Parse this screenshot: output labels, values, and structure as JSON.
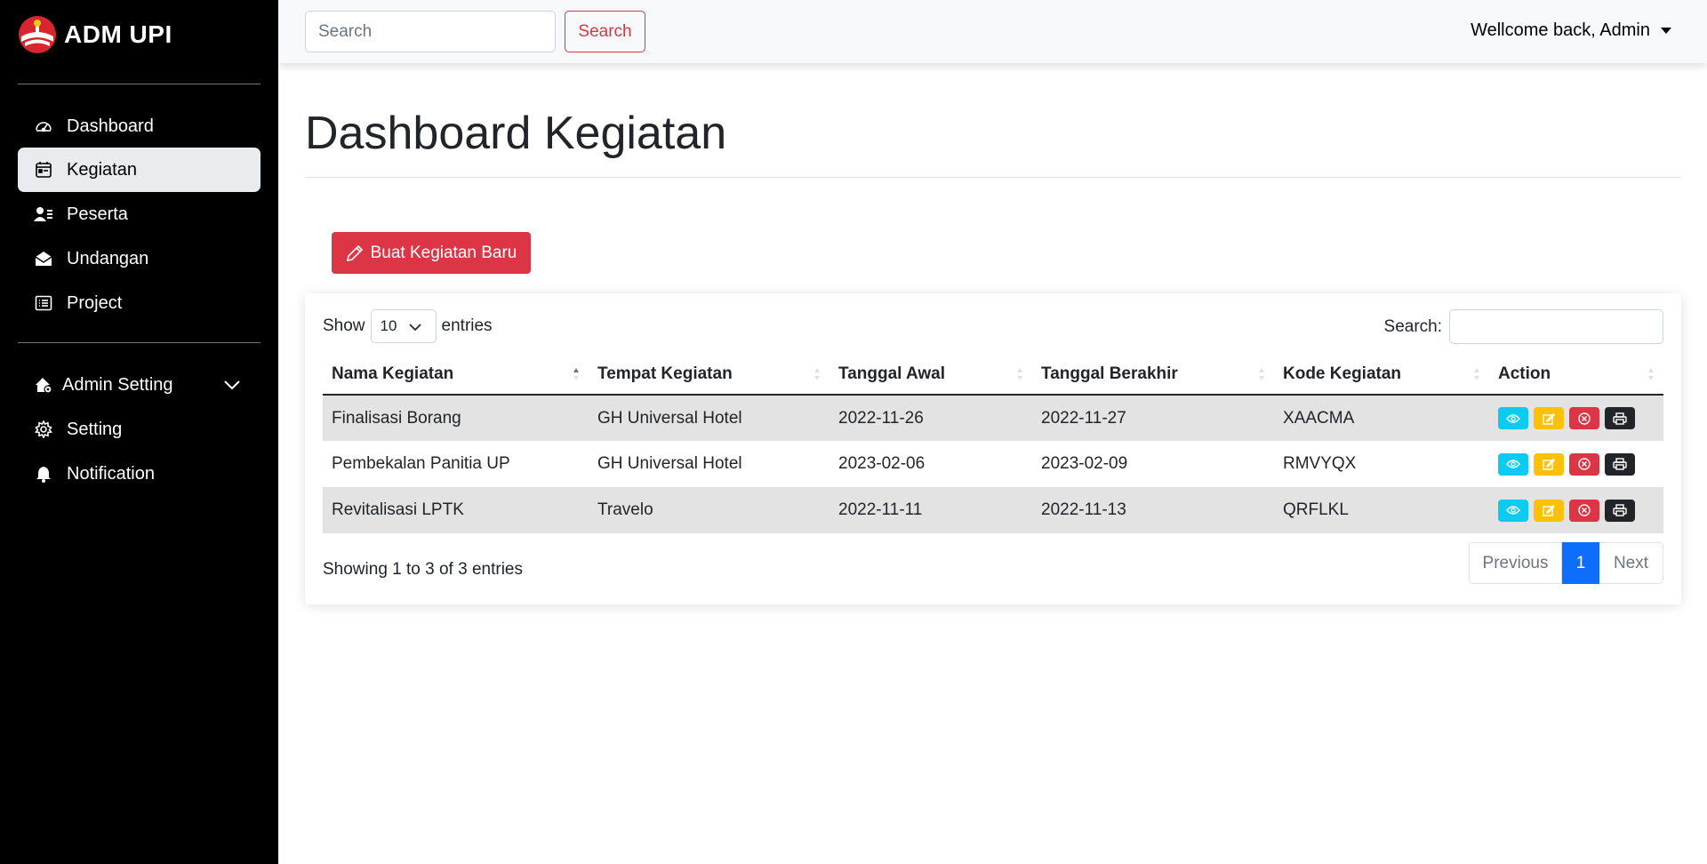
{
  "sidebar": {
    "brand": "ADM UPI",
    "items": [
      {
        "label": "Dashboard",
        "icon": "speedometer-icon"
      },
      {
        "label": "Kegiatan",
        "icon": "calendar-icon",
        "active": true
      },
      {
        "label": "Peserta",
        "icon": "people-icon"
      },
      {
        "label": "Undangan",
        "icon": "envelope-icon"
      },
      {
        "label": "Project",
        "icon": "list-icon"
      }
    ],
    "admin_items": [
      {
        "label": "Admin Setting",
        "icon": "house-gear-icon"
      },
      {
        "label": "Setting",
        "icon": "gear-icon"
      },
      {
        "label": "Notification",
        "icon": "bell-icon"
      }
    ]
  },
  "topbar": {
    "search_placeholder": "Search",
    "search_button": "Search",
    "user_greeting": "Wellcome back, Admin"
  },
  "main": {
    "title": "Dashboard Kegiatan",
    "new_button": "Buat Kegiatan Baru"
  },
  "table": {
    "length_prefix": "Show",
    "length_value": "10",
    "length_suffix": "entries",
    "search_label": "Search:",
    "columns": [
      "Nama Kegiatan",
      "Tempat Kegiatan",
      "Tanggal Awal",
      "Tanggal Berakhir",
      "Kode Kegiatan",
      "Action"
    ],
    "rows": [
      [
        "Finalisasi Borang",
        "GH Universal Hotel",
        "2022-11-26",
        "2022-11-27",
        "XAACMA"
      ],
      [
        "Pembekalan Panitia UP",
        "GH Universal Hotel",
        "2023-02-06",
        "2023-02-09",
        "RMVYQX"
      ],
      [
        "Revitalisasi LPTK",
        "Travelo",
        "2022-11-11",
        "2022-11-13",
        "QRFLKL"
      ]
    ],
    "info": "Showing 1 to 3 of 3 entries",
    "pagination": {
      "previous": "Previous",
      "current": "1",
      "next": "Next"
    }
  },
  "colors": {
    "primary": "#0d6efd",
    "danger": "#dc3545",
    "info": "#0dcaf0",
    "warning": "#ffc107",
    "dark": "#212529"
  }
}
